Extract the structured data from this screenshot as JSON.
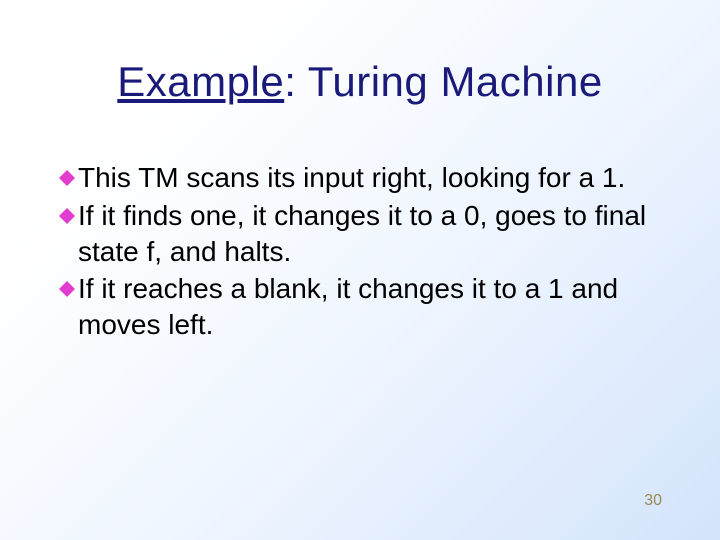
{
  "title": {
    "underlined": "Example",
    "rest": ": Turing Machine"
  },
  "bullets": [
    "This TM scans its input right, looking for a 1.",
    "If it finds one, it changes it to a 0, goes to final state f, and halts.",
    "If it reaches a blank, it changes it to a 1 and moves left."
  ],
  "page_number": "30",
  "colors": {
    "title": "#1a1a7a",
    "bullet_diamond": "#e23ccf",
    "page_number": "#9a8a55"
  }
}
